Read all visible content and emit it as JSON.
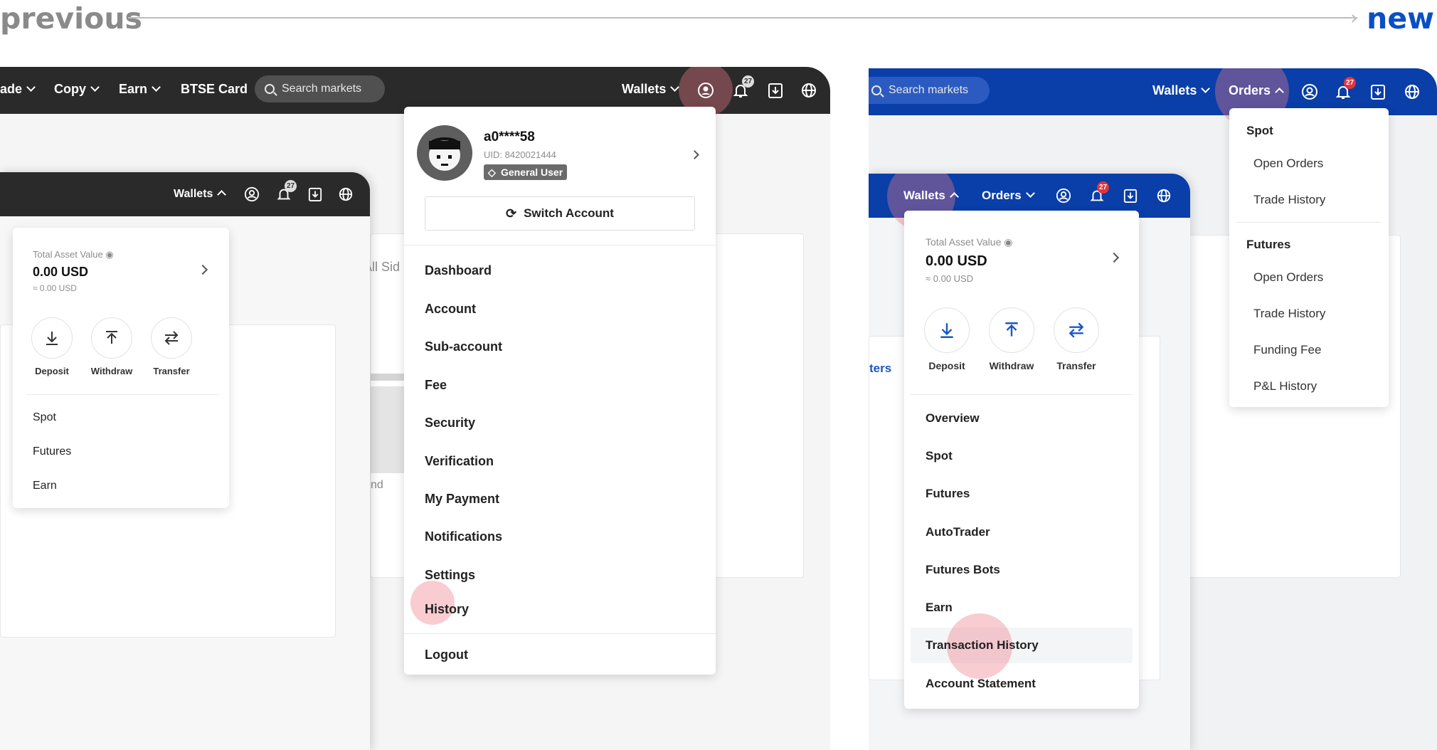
{
  "header": {
    "previous_label": "previous",
    "new_label": "new"
  },
  "left": {
    "topbar": {
      "nav": [
        "ade",
        "Copy",
        "Earn",
        "BTSE Card"
      ],
      "search_placeholder": "Search markets",
      "wallets_label": "Wallets",
      "notification_count": "27"
    },
    "inner_topbar": {
      "wallets_label": "Wallets",
      "notification_count": "27"
    },
    "wallet_card": {
      "total_label": "Total Asset Value",
      "total_value": "0.00 USD",
      "total_approx": "≈ 0.00 USD",
      "actions": [
        "Deposit",
        "Withdraw",
        "Transfer"
      ],
      "items": [
        "Spot",
        "Futures",
        "Earn"
      ]
    },
    "background_text": {
      "all_sides": "All Sid",
      "and": "nd"
    },
    "account_menu": {
      "username": "a0****58",
      "uid": "UID: 8420021444",
      "user_type": "General User",
      "switch_account": "Switch Account",
      "items": [
        "Dashboard",
        "Account",
        "Sub-account",
        "Fee",
        "Security",
        "Verification",
        "My Payment",
        "Notifications",
        "Settings",
        "History"
      ],
      "logout": "Logout"
    }
  },
  "right": {
    "topbar": {
      "search_placeholder": "Search markets",
      "wallets_label": "Wallets",
      "orders_label": "Orders",
      "notification_count": "27"
    },
    "inner_topbar": {
      "wallets_label": "Wallets",
      "orders_label": "Orders",
      "notification_count": "27"
    },
    "background_text": {
      "ters": "ters"
    },
    "orders_menu": {
      "spot_heading": "Spot",
      "spot_items": [
        "Open Orders",
        "Trade History"
      ],
      "futures_heading": "Futures",
      "futures_items": [
        "Open Orders",
        "Trade History",
        "Funding Fee",
        "P&L History"
      ]
    },
    "wallet_card": {
      "total_label": "Total Asset Value",
      "total_value": "0.00 USD",
      "total_approx": "≈ 0.00 USD",
      "actions": [
        "Deposit",
        "Withdraw",
        "Transfer"
      ],
      "items": [
        "Overview",
        "Spot",
        "Futures",
        "AutoTrader",
        "Futures Bots",
        "Earn",
        "Transaction History",
        "Account Statement"
      ]
    }
  },
  "colors": {
    "dark_bar": "#2a2a2a",
    "blue_bar": "#0a3ea8",
    "new_accent": "#0a4fc4",
    "highlight": "#ec7887",
    "badge_red": "#e5333a",
    "action_blue": "#1a57c9"
  }
}
